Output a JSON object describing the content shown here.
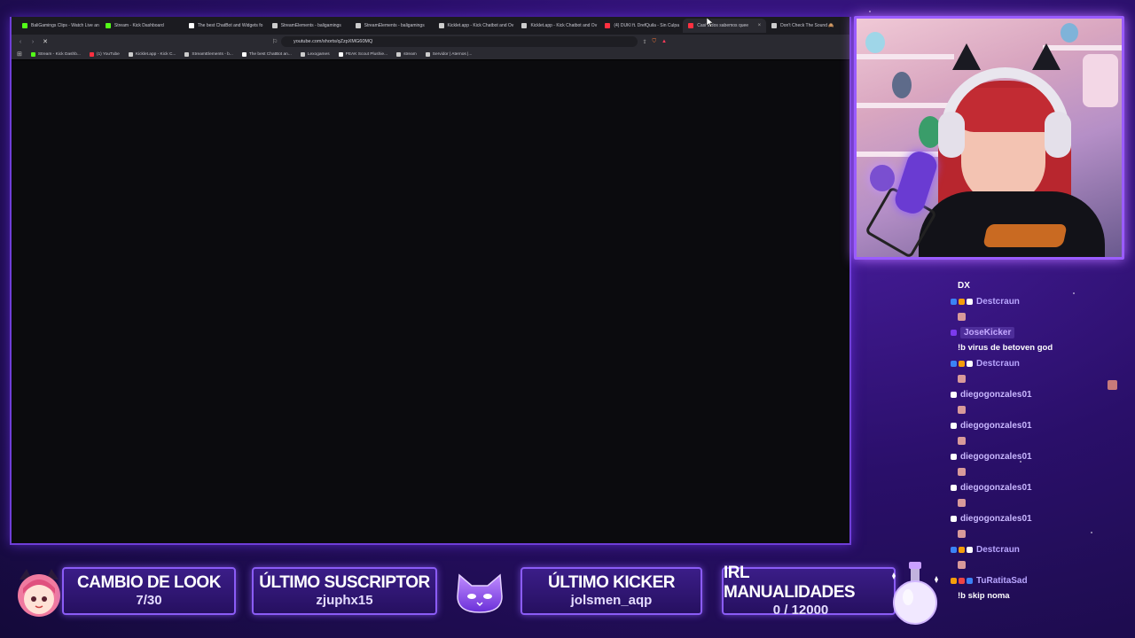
{
  "browser": {
    "tabs": [
      {
        "label": "BaliGamings Clips - Watch Live an",
        "color": "#53fc18"
      },
      {
        "label": "Stream - Kick Dashboard",
        "color": "#53fc18"
      },
      {
        "label": "The best ChatBot and Widgets fo",
        "color": "#ffffff"
      },
      {
        "label": "StreamElements - baligamings",
        "color": "#cccccc"
      },
      {
        "label": "StreamElements - baligamings",
        "color": "#cccccc"
      },
      {
        "label": "Kicklet.app - Kick Chatbot and Ov",
        "color": "#cccccc"
      },
      {
        "label": "Kicklet.app - Kick Chatbot and Ov",
        "color": "#cccccc"
      },
      {
        "label": "(4) DUKI ft. DrefQuila - Sin Culpa",
        "color": "#ff3040"
      },
      {
        "label": "Casi todos sabemos quee",
        "color": "#ff3040",
        "active": true
      },
      {
        "label": "Don't Check The Sound 🙈",
        "color": "#cccccc"
      }
    ],
    "address": "youtube.com/shorts/qZzpXMG60MQ",
    "bookmarks": [
      {
        "label": "Stream - Kick Dashb...",
        "color": "#53fc18"
      },
      {
        "label": "(1) YouTube",
        "color": "#ff3040"
      },
      {
        "label": "Kicklet.app - Kick C...",
        "color": "#cccccc"
      },
      {
        "label": "StreamElements - b...",
        "color": "#cccccc"
      },
      {
        "label": "The best ChatBot an...",
        "color": "#ffffff"
      },
      {
        "label": "Lexogames",
        "color": "#cccccc"
      },
      {
        "label": "PEAK Scout Plushie...",
        "color": "#ffffff"
      },
      {
        "label": "stream",
        "color": "#cccccc"
      },
      {
        "label": "Servidor | Aternos |...",
        "color": "#cccccc"
      }
    ]
  },
  "chat": {
    "first_line": "DX",
    "lines": [
      {
        "type": "user",
        "name": "Destcraun",
        "color": "#b9a6ff",
        "badges": [
          "#3b82f6",
          "#f59e0b",
          "#ffffff"
        ]
      },
      {
        "type": "emote"
      },
      {
        "type": "user",
        "name": "JoseKicker",
        "color": "#c4a8ff",
        "badges": [
          "#7c3aed"
        ],
        "pill": true
      },
      {
        "type": "msg",
        "text": "!b virus de betoven god"
      },
      {
        "type": "user",
        "name": "Destcraun",
        "color": "#b9a6ff",
        "badges": [
          "#3b82f6",
          "#f59e0b",
          "#ffffff"
        ]
      },
      {
        "type": "emote"
      },
      {
        "type": "user",
        "name": "diegogonzales01",
        "color": "#c9b8ff",
        "badges": [
          "#ffffff"
        ]
      },
      {
        "type": "emote"
      },
      {
        "type": "user",
        "name": "diegogonzales01",
        "color": "#c9b8ff",
        "badges": [
          "#ffffff"
        ]
      },
      {
        "type": "emote"
      },
      {
        "type": "user",
        "name": "diegogonzales01",
        "color": "#c9b8ff",
        "badges": [
          "#ffffff"
        ]
      },
      {
        "type": "emote"
      },
      {
        "type": "user",
        "name": "diegogonzales01",
        "color": "#c9b8ff",
        "badges": [
          "#ffffff"
        ]
      },
      {
        "type": "emote"
      },
      {
        "type": "user",
        "name": "diegogonzales01",
        "color": "#c9b8ff",
        "badges": [
          "#ffffff"
        ]
      },
      {
        "type": "emote"
      },
      {
        "type": "user",
        "name": "Destcraun",
        "color": "#b9a6ff",
        "badges": [
          "#3b82f6",
          "#f59e0b",
          "#ffffff"
        ]
      },
      {
        "type": "emote"
      },
      {
        "type": "user",
        "name": "TuRatitaSad",
        "color": "#b9a6ff",
        "badges": [
          "#f59e0b",
          "#ef4444",
          "#3b82f6"
        ]
      },
      {
        "type": "msg",
        "text": "!b skip noma"
      }
    ]
  },
  "widgets": {
    "look": {
      "title": "CAMBIO DE LOOK",
      "value": "7/30"
    },
    "sub": {
      "title": "ÚLTIMO SUSCRIPTOR",
      "value": "zjuphx15"
    },
    "kicker": {
      "title": "ÚLTIMO KICKER",
      "value": "jolsmen_aqp"
    },
    "irl": {
      "title": "IRL MANUALIDADES",
      "value": "0 / 12000"
    }
  },
  "colors": {
    "accent": "#8b5cf6",
    "kick_green": "#53fc18",
    "youtube_red": "#ff3040"
  }
}
